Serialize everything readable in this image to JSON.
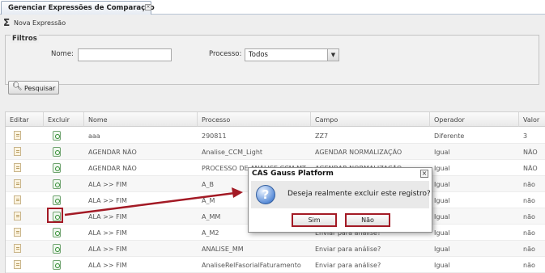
{
  "tab": {
    "title": "Gerenciar Expressões de Comparação",
    "close": "×"
  },
  "toolbar": {
    "new_label": "Nova Expressão",
    "new_icon": "sigma-icon"
  },
  "filters": {
    "legend": "Filtros",
    "name_label": "Nome:",
    "name_value": "",
    "process_label": "Processo:",
    "process_value": "Todos",
    "search_label": "Pesquisar"
  },
  "grid": {
    "columns": [
      "Editar",
      "Excluir",
      "Nome",
      "Processo",
      "Campo",
      "Operador",
      "Valor"
    ],
    "rows": [
      {
        "nome": "aaa",
        "processo": "290811",
        "campo": "ZZ7",
        "operador": "Diferente",
        "valor": "3"
      },
      {
        "nome": "AGENDAR NÃO",
        "processo": "Analise_CCM_Light",
        "campo": "AGENDAR NORMALIZAÇÃO",
        "operador": "Igual",
        "valor": "NÃO"
      },
      {
        "nome": "AGENDAR NÃO",
        "processo": "PROCESSO DE ANÁLISE CCM MT",
        "campo": "AGENDAR NORMALIZAÇÃO",
        "operador": "Igual",
        "valor": "NÃO"
      },
      {
        "nome": "ALA >> FIM",
        "processo": "A_B",
        "campo": "",
        "operador": "Igual",
        "valor": "não"
      },
      {
        "nome": "ALA >> FIM",
        "processo": "A_M",
        "campo": "",
        "operador": "Igual",
        "valor": "não"
      },
      {
        "nome": "ALA >> FIM",
        "processo": "A_MM",
        "campo": "",
        "operador": "Igual",
        "valor": "não"
      },
      {
        "nome": "ALA >> FIM",
        "processo": "A_M2",
        "campo": "Enviar para análise?",
        "operador": "Igual",
        "valor": "não"
      },
      {
        "nome": "ALA >> FIM",
        "processo": "ANALISE_MM",
        "campo": "Enviar para análise?",
        "operador": "Igual",
        "valor": "não"
      },
      {
        "nome": "ALA >> FIM",
        "processo": "AnaliseRelFasorialFaturamento",
        "campo": "Enviar para análise?",
        "operador": "Igual",
        "valor": "não"
      }
    ]
  },
  "dialog": {
    "title": "CAS Gauss Platform",
    "message": "Deseja realmente excluir este registro?",
    "yes_label": "Sim",
    "no_label": "Não",
    "close": "×",
    "icon": "question-icon"
  },
  "annotation": {
    "color": "#a31a25"
  }
}
